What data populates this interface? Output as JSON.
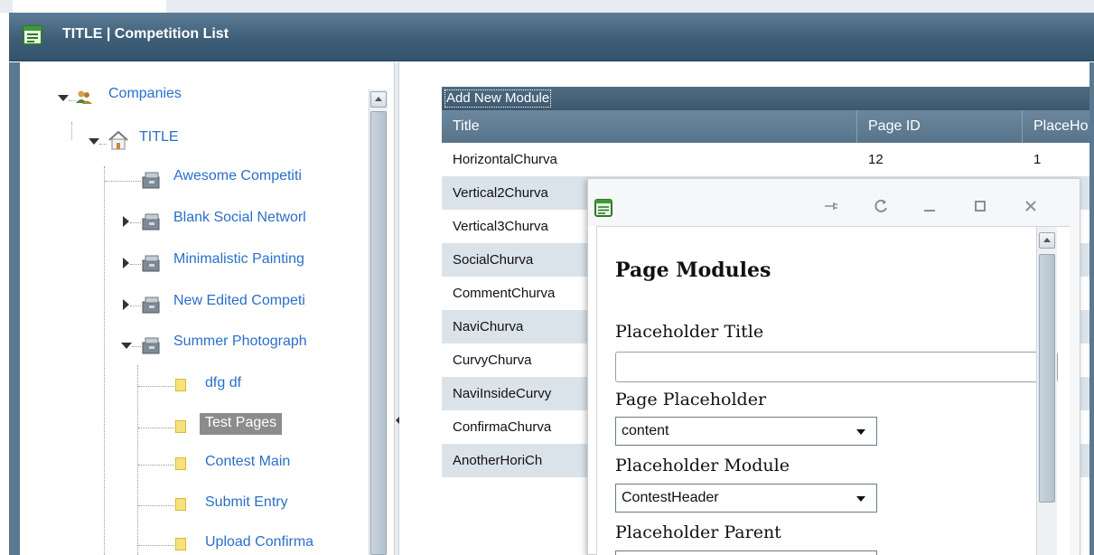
{
  "window": {
    "title": "TITLE | Competition List"
  },
  "tree": {
    "root": {
      "label": "Companies"
    },
    "company": {
      "label": "TITLE"
    },
    "competitions": [
      {
        "label": "Awesome Competiti"
      },
      {
        "label": "Blank Social Networl"
      },
      {
        "label": "Minimalistic Painting"
      },
      {
        "label": "New Edited Competi"
      },
      {
        "label": "Summer Photograph"
      }
    ],
    "pages": [
      {
        "label": "dfg df"
      },
      {
        "label": "Test Pages"
      },
      {
        "label": "Contest Main"
      },
      {
        "label": "Submit Entry"
      },
      {
        "label": "Upload Confirma"
      }
    ]
  },
  "grid": {
    "toolbar": {
      "add_label": "Add New Module"
    },
    "columns": [
      "Title",
      "Page ID",
      "PlaceHo"
    ],
    "rows": [
      {
        "title": "HorizontalChurva",
        "page_id": "12",
        "placeholder": "1"
      },
      {
        "title": "Vertical2Churva",
        "page_id": "",
        "placeholder": ""
      },
      {
        "title": "Vertical3Churva",
        "page_id": "",
        "placeholder": ""
      },
      {
        "title": "SocialChurva",
        "page_id": "",
        "placeholder": ""
      },
      {
        "title": "CommentChurva",
        "page_id": "",
        "placeholder": ""
      },
      {
        "title": "NaviChurva",
        "page_id": "",
        "placeholder": ""
      },
      {
        "title": "CurvyChurva",
        "page_id": "",
        "placeholder": ""
      },
      {
        "title": "NaviInsideCurvy",
        "page_id": "",
        "placeholder": ""
      },
      {
        "title": "ConfirmaChurva",
        "page_id": "",
        "placeholder": ""
      },
      {
        "title": "AnotherHoriCh",
        "page_id": "",
        "placeholder": ""
      }
    ]
  },
  "dialog": {
    "heading": "Page Modules",
    "placeholder_title_label": "Placeholder Title",
    "placeholder_title_value": "",
    "page_placeholder_label": "Page Placeholder",
    "page_placeholder_value": "content",
    "placeholder_module_label": "Placeholder Module",
    "placeholder_module_value": "ContestHeader",
    "placeholder_parent_label": "Placeholder Parent"
  },
  "colors": {
    "titlebar": "#3e5d76",
    "link": "#2a6fc9",
    "grid_header": "#6c879d",
    "row_alt": "#dbe3ea",
    "selection": "#8c8c8c"
  }
}
